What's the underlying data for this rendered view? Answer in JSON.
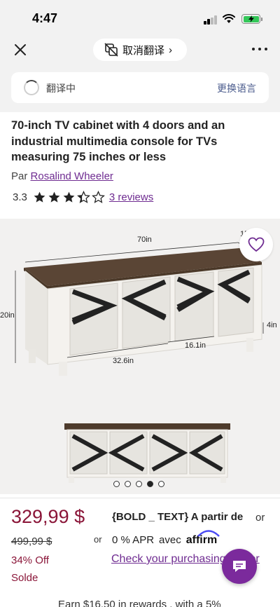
{
  "status_bar": {
    "time": "4:47"
  },
  "translate_bar": {
    "pill_label": "取消翻译",
    "status_text": "翻译中",
    "switch_language": "更换语言"
  },
  "product": {
    "title": "70-inch TV cabinet with 4 doors and an industrial multimedia console for TVs measuring 75 inches or less",
    "brand_prefix": "Par",
    "brand_name": "Rosalind Wheeler",
    "rating": "3.3",
    "rating_value": 3.3,
    "reviews_label": "3 reviews"
  },
  "gallery": {
    "dimensions": {
      "width": "70in",
      "depth": "15.5in",
      "height": "20in",
      "leg": "4in",
      "door_width": "16.1in",
      "section_width": "32.6in"
    },
    "image_count": 5,
    "active_index": 3
  },
  "pricing": {
    "price": "329,99 $",
    "old_price": "499,99 $",
    "discount": "34% Off",
    "sale_tag": "Solde",
    "or_text": "or",
    "bold_text": "{BOLD _ TEXT} A partir de",
    "apr_text": "0 % APR",
    "avec_text": "avec",
    "affirm_brand": "affirm",
    "check_link": "Check your purchasing power",
    "rewards_text": "Earn $16.50 in rewards , with a 5%"
  },
  "colors": {
    "accent_purple": "#6f2c91",
    "price_red": "#8a1538",
    "chat_button": "#7b2a9c",
    "battery_green": "#34c759"
  }
}
